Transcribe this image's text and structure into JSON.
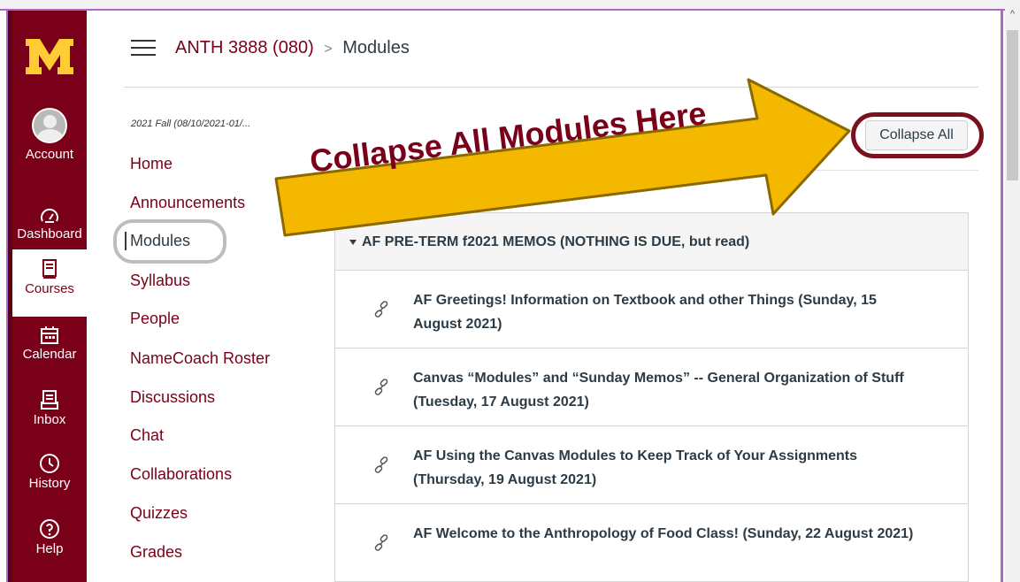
{
  "breadcrumb": {
    "course": "ANTH 3888 (080)",
    "separator": ">",
    "current": "Modules"
  },
  "global_nav": {
    "items": [
      {
        "label": "Account",
        "icon": "avatar"
      },
      {
        "label": "Dashboard",
        "icon": "dashboard-icon"
      },
      {
        "label": "Courses",
        "icon": "book-icon"
      },
      {
        "label": "Calendar",
        "icon": "calendar-icon"
      },
      {
        "label": "Inbox",
        "icon": "inbox-icon"
      },
      {
        "label": "History",
        "icon": "clock-icon"
      },
      {
        "label": "Help",
        "icon": "help-icon"
      }
    ],
    "active": "Courses"
  },
  "course_nav": {
    "term": "2021 Fall (08/10/2021-01/...",
    "items": [
      "Home",
      "Announcements",
      "Modules",
      "Syllabus",
      "People",
      "NameCoach Roster",
      "Discussions",
      "Chat",
      "Collaborations",
      "Quizzes",
      "Grades"
    ],
    "active": "Modules"
  },
  "toolbar": {
    "collapse_all_label": "Collapse All"
  },
  "annotation": {
    "arrow_text": "Collapse All Modules Here"
  },
  "module": {
    "title": "AF PRE-TERM f2021 MEMOS (NOTHING IS DUE, but read)",
    "items": [
      {
        "title": "AF Greetings! Information on Textbook and other Things (Sunday, 15 August 2021)"
      },
      {
        "title": "Canvas “Modules” and “Sunday Memos” -- General Organization of Stuff (Tuesday, 17 August 2021)"
      },
      {
        "title": "AF Using the Canvas Modules to Keep Track of Your Assignments (Thursday, 19 August 2021)"
      },
      {
        "title": "AF Welcome to the Anthropology of Food Class! (Sunday, 22 August 2021)"
      }
    ]
  },
  "colors": {
    "brand_maroon": "#7a0019",
    "brand_gold": "#ffcc33",
    "arrow_fill": "#f5b800",
    "annotation_ring": "#7a1020"
  }
}
